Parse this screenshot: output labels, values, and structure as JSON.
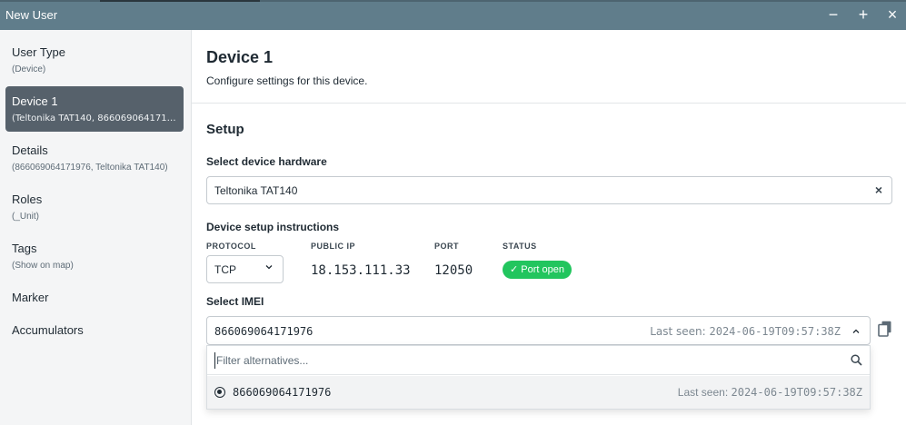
{
  "window": {
    "title": "New User",
    "controls": {
      "minimize": "−",
      "maximize": "+",
      "close": "×"
    }
  },
  "sidebar": {
    "items": [
      {
        "label": "User Type",
        "sub": "(Device)"
      },
      {
        "label": "Device 1",
        "sub": "(Teltonika TAT140, 866069064171976)",
        "active": true
      },
      {
        "label": "Details",
        "sub": "(866069064171976, Teltonika TAT140)"
      },
      {
        "label": "Roles",
        "sub": "(_Unit)"
      },
      {
        "label": "Tags",
        "sub": "(Show on map)"
      },
      {
        "label": "Marker",
        "sub": ""
      },
      {
        "label": "Accumulators",
        "sub": ""
      }
    ]
  },
  "main": {
    "title": "Device 1",
    "subtitle": "Configure settings for this device.",
    "section": "Setup",
    "hardware": {
      "label": "Select device hardware",
      "value": "Teltonika TAT140",
      "clear": "×"
    },
    "instructions": {
      "label": "Device setup instructions",
      "protocol_header": "PROTOCOL",
      "protocol_value": "TCP",
      "ip_header": "PUBLIC IP",
      "ip_value": "18.153.111.33",
      "port_header": "PORT",
      "port_value": "12050",
      "status_header": "STATUS",
      "status_value": "✓ Port open",
      "status_color": "#22c55e"
    },
    "imei": {
      "label": "Select IMEI",
      "value": "866069064171976",
      "last_seen_label": "Last seen: ",
      "last_seen_value": "2024-06-19T09:57:38Z",
      "filter_placeholder": "Filter alternatives...",
      "options": [
        {
          "value": "866069064171976",
          "last_seen_label": "Last seen: ",
          "last_seen_value": "2024-06-19T09:57:38Z",
          "selected": true
        }
      ]
    }
  }
}
